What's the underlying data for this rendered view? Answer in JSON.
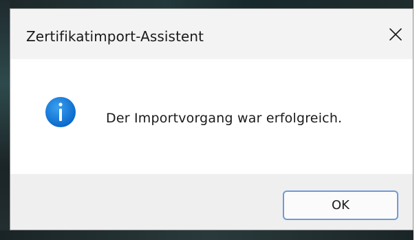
{
  "dialog": {
    "title": "Zertifikatimport-Assistent",
    "message": "Der Importvorgang war erfolgreich.",
    "ok_label": "OK",
    "icon": "info-icon",
    "close_icon": "close-icon"
  },
  "colors": {
    "titlebar_bg": "#f3f3f3",
    "footer_bg": "#efefef",
    "accent": "#0a74d6",
    "button_border": "#6f9ad6"
  }
}
